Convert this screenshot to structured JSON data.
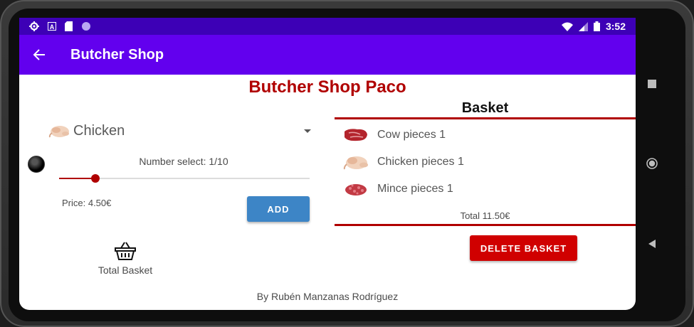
{
  "status_bar": {
    "time": "3:52",
    "icons": [
      "settings-icon",
      "a-icon",
      "sd-card-icon",
      "circle-icon",
      "wifi-icon",
      "signal-icon",
      "battery-icon"
    ]
  },
  "app_bar": {
    "title": "Butcher Shop",
    "back_icon": "arrow-back-icon",
    "color": "#6200ee"
  },
  "shop_title": "Butcher Shop Paco",
  "product_selector": {
    "selected": "Chicken",
    "icon": "chicken-icon"
  },
  "quantity": {
    "label": "Number select: 1/10",
    "value": 1,
    "max": 10
  },
  "price_label": "Price: 4.50€",
  "add_button_label": "ADD",
  "total_basket_label": "Total Basket",
  "basket": {
    "title": "Basket",
    "items": [
      {
        "label": "Cow pieces 1",
        "icon": "beef-icon"
      },
      {
        "label": "Chicken pieces 1",
        "icon": "chicken-icon"
      },
      {
        "label": "Mince pieces 1",
        "icon": "mince-icon"
      }
    ],
    "total": "Total 11.50€"
  },
  "delete_button_label": "DELETE BASKET",
  "footer": "By Rubén Manzanas Rodríguez",
  "colors": {
    "accent_red": "#b00000",
    "add_blue": "#3d85c6",
    "delete_red": "#d00000"
  }
}
